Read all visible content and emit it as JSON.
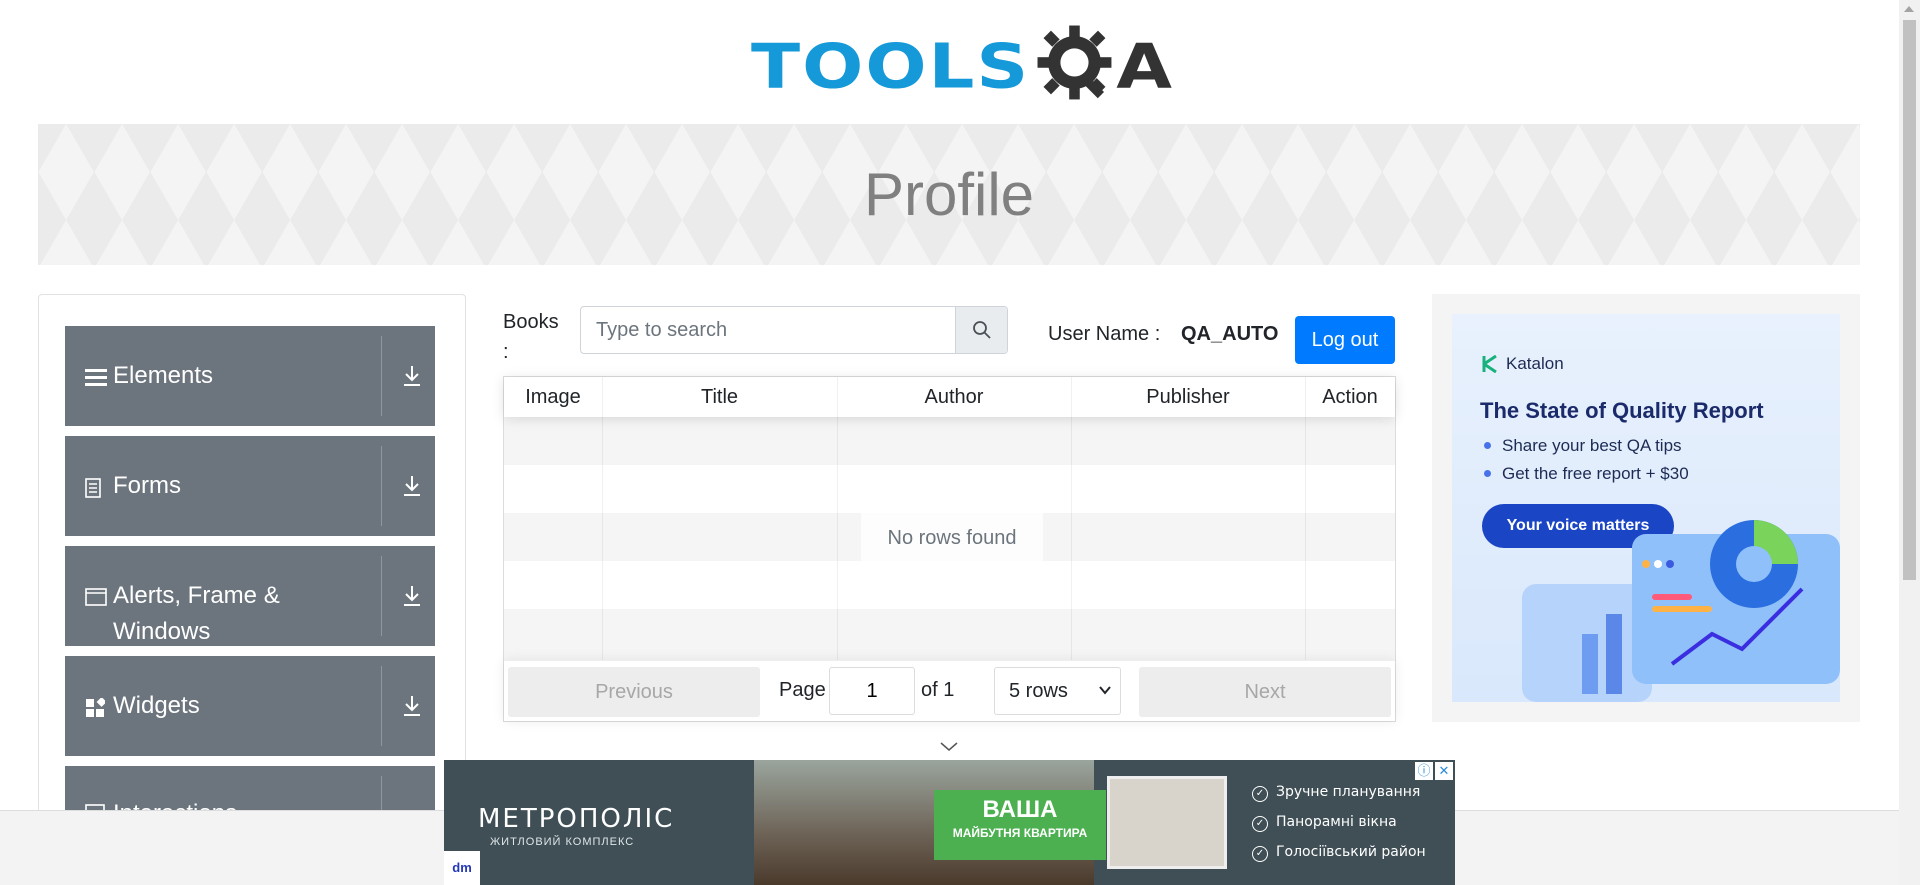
{
  "header": {
    "logo_text_left": "TOOLS",
    "logo_text_right": "A"
  },
  "banner": {
    "title": "Profile"
  },
  "menu": {
    "items": [
      {
        "label": "Elements",
        "icon": "hamburger-icon"
      },
      {
        "label": "Forms",
        "icon": "document-icon"
      },
      {
        "label": "Alerts, Frame & Windows",
        "icon": "window-icon"
      },
      {
        "label": "Widgets",
        "icon": "widgets-icon"
      },
      {
        "label": "Interactions",
        "icon": "interactions-icon"
      }
    ]
  },
  "books": {
    "label": "Books :",
    "search_placeholder": "Type to search"
  },
  "user": {
    "label": "User Name :",
    "value": "QA_AUTO",
    "logout_label": "Log out"
  },
  "table": {
    "columns": [
      "Image",
      "Title",
      "Author",
      "Publisher",
      "Action"
    ],
    "empty_text": "No rows found",
    "pagination": {
      "previous": "Previous",
      "page_label": "Page",
      "page_value": "1",
      "of_label": "of 1",
      "rows_label": "5 rows",
      "next": "Next"
    }
  },
  "ad_right": {
    "brand": "Katalon",
    "title": "The State of Quality Report",
    "bullets": [
      "Share your best QA tips",
      "Get the free report + $30"
    ],
    "cta": "Your voice matters"
  },
  "ad_bottom": {
    "brand": "МЕТРОПОЛІС",
    "subtitle": "ЖИТЛОВИЙ КОМПЛЕКС",
    "badge_big": "ВАША",
    "badge_small": "МАЙБУТНЯ КВАРТИРА",
    "features": [
      "Зручне планування",
      "Панорамні вікна",
      "Голосіївський район"
    ],
    "logo": "dm"
  },
  "colors": {
    "accent": "#007bff",
    "menu_bg": "#6c757d",
    "logo_blue": "#1599d9"
  }
}
